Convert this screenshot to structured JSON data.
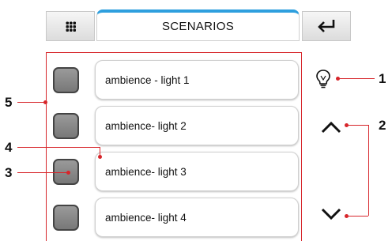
{
  "header": {
    "title": "SCENARIOS",
    "menu_icon": "grid-icon",
    "back_icon": "enter-return-icon"
  },
  "scenarios": [
    {
      "label": "ambience - light 1"
    },
    {
      "label": "ambience- light 2"
    },
    {
      "label": "ambience- light 3"
    },
    {
      "label": "ambience- light 4"
    }
  ],
  "side_controls": {
    "bulb_icon": "light-bulb-icon",
    "up_icon": "chevron-up-icon",
    "down_icon": "chevron-down-icon"
  },
  "callouts": {
    "one": "1",
    "two": "2",
    "three": "3",
    "four": "4",
    "five": "5"
  },
  "colors": {
    "accent": "#2e9fde",
    "annotation": "#d7262b",
    "checkbox": "#888888"
  }
}
